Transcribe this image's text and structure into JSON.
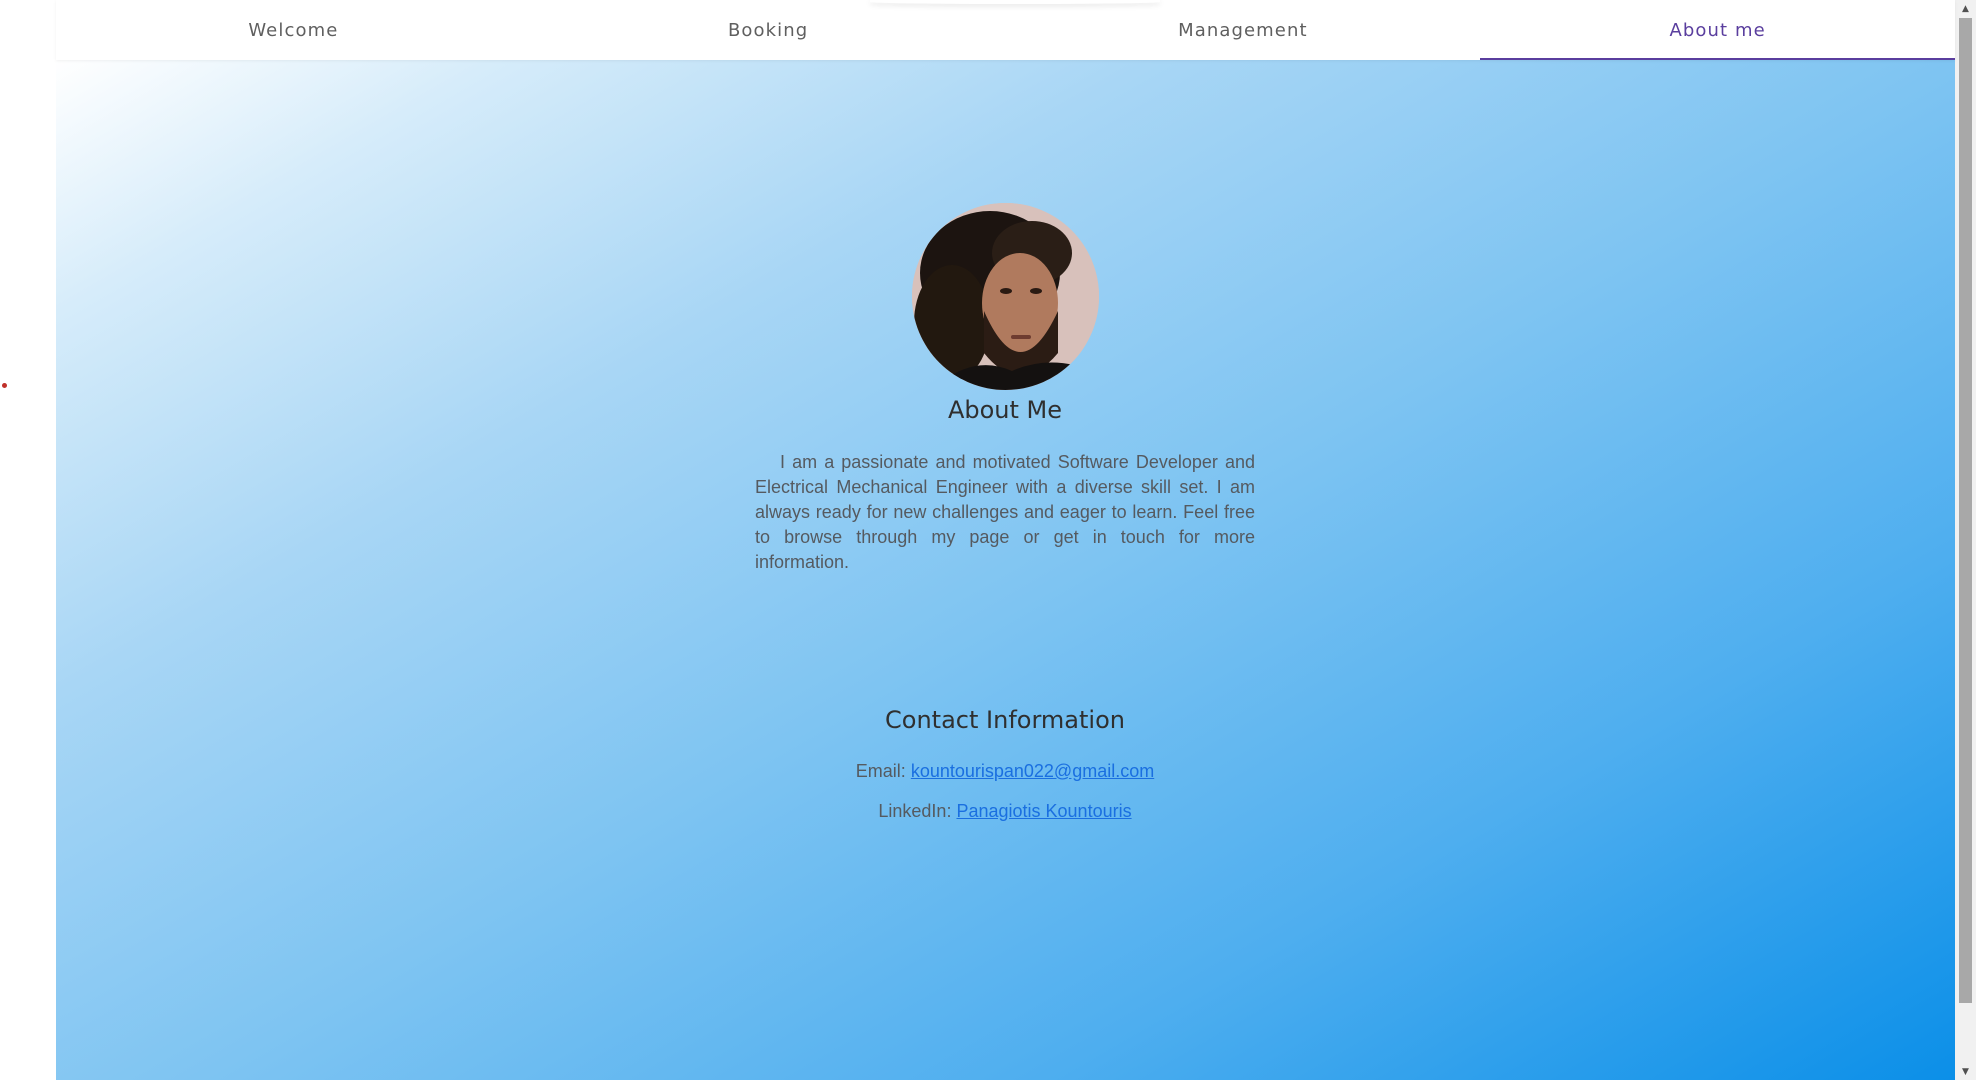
{
  "nav": {
    "tabs": [
      {
        "label": "Welcome",
        "active": false
      },
      {
        "label": "Booking",
        "active": false
      },
      {
        "label": "Management",
        "active": false
      },
      {
        "label": "About me",
        "active": true
      }
    ]
  },
  "about": {
    "title": "About Me",
    "text": "I am a passionate and motivated Software Developer and Electrical Mechanical Engineer with a diverse skill set. I am always ready for new challenges and eager to learn. Feel free to browse through my page or get in touch for more information."
  },
  "contact": {
    "title": "Contact Information",
    "email_label": "Email:",
    "email_value": "kountourispan022@gmail.com",
    "linkedin_label": "LinkedIn:",
    "linkedin_value": "Panagiotis Kountouris"
  },
  "colors": {
    "accent": "#5a3e9e",
    "link": "#1a6fe0",
    "gradient_start": "#ffffff",
    "gradient_end": "#0b8fe8"
  },
  "icons": {
    "scroll_up": "scroll-up-arrow-icon",
    "scroll_down": "scroll-down-arrow-icon"
  }
}
